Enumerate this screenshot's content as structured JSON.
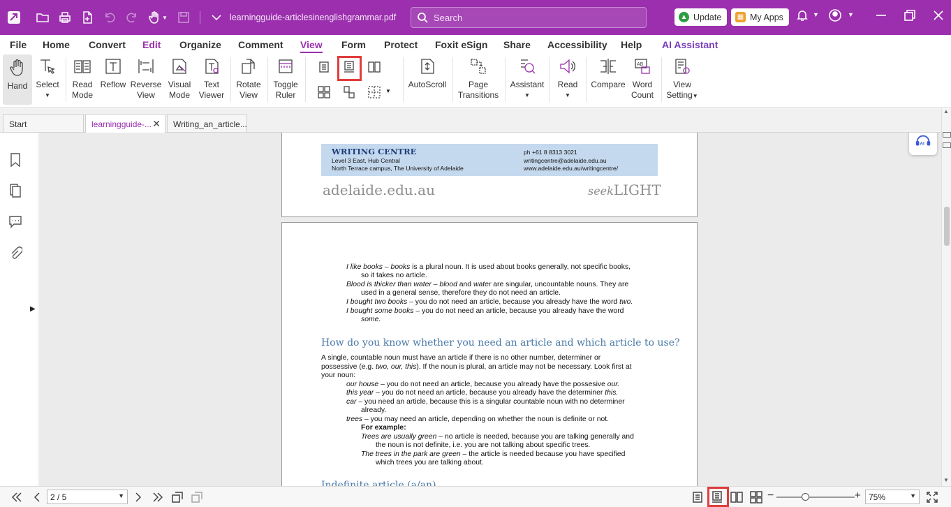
{
  "titlebar": {
    "filename": "learningguide-articlesinenglishgrammar.pdf",
    "search_placeholder": "Search",
    "update_label": "Update",
    "myapps_label": "My Apps"
  },
  "menu": [
    "File",
    "Home",
    "Convert",
    "Edit",
    "Organize",
    "Comment",
    "View",
    "Form",
    "Protect",
    "Foxit eSign",
    "Share",
    "Accessibility",
    "Help",
    "AI Assistant"
  ],
  "ribbon": {
    "hand": "Hand",
    "select": "Select",
    "read_mode_1": "Read",
    "read_mode_2": "Mode",
    "reflow": "Reflow",
    "reverse_1": "Reverse",
    "reverse_2": "View",
    "visual_1": "Visual",
    "visual_2": "Mode",
    "text_1": "Text",
    "text_2": "Viewer",
    "rotate_1": "Rotate",
    "rotate_2": "View",
    "ruler_1": "Toggle",
    "ruler_2": "Ruler",
    "autoscroll": "AutoScroll",
    "transitions_1": "Page",
    "transitions_2": "Transitions",
    "assistant": "Assistant",
    "read": "Read",
    "compare": "Compare",
    "word_1": "Word",
    "word_2": "Count",
    "setting_1": "View",
    "setting_2": "Setting"
  },
  "tabs": {
    "start": "Start",
    "tab1": "learningguide-...",
    "tab2": "Writing_an_article..."
  },
  "page1": {
    "centre": "WRITING CENTRE",
    "addr1": "Level 3 East, Hub Central",
    "addr2": "North Terrace campus, The University of Adelaide",
    "phone": "ph  +61 8 8313 3021",
    "email": "writingcentre@adelaide.edu.au",
    "web": "www.adelaide.edu.au/writingcentre/",
    "domain": "adelaide.edu.au",
    "seek": "seek",
    "light": "LIGHT"
  },
  "page2": {
    "l1a": "I like books –",
    "l1b": " books",
    "l1c": " is a plural noun. It is used about books generally, not specific books,",
    "l2": "so it takes no article.",
    "l3a": "Blood is thicker than water –",
    "l3b": " blood",
    "l3c": " and ",
    "l3d": "water",
    "l3e": " are singular, uncountable nouns. They are",
    "l4": "used in a general sense, therefore they do not need an article.",
    "l5a": "I bought two books –",
    "l5b": " you do not need an article, because you already have the word ",
    "l5c": "two.",
    "l6a": "I bought some books –",
    "l6b": " you do not need an article, because you already have the word",
    "l7": "some.",
    "heading": "How do you know whether you need an article and which article to use?",
    "p1": "A single, countable noun must have an article if there is no other number, determiner or",
    "p2a": "possessive (e.g. ",
    "p2b": "two, our, this",
    "p2c": "). If the noun is plural, an article may not be necessary. Look first at",
    "p3": "your noun:",
    "e1a": "our house –",
    "e1b": " you do not need an article, because you already have the possesive ",
    "e1c": "our.",
    "e2a": "this year –",
    "e2b": " you do not need an article, because you already have the determiner ",
    "e2c": "this.",
    "e3a": "car –",
    "e3b": " you need an article, because this is a singular countable noun with no determiner",
    "e4": "already.",
    "e5a": "trees –",
    "e5b": " you may need an article, depending on whether the noun is definite or not.",
    "fe": "For example:",
    "f1a": "Trees are usually green –",
    "f1b": " no article is needed, because you are talking generally and",
    "f2": "the noun is not definite, i.e. you are not talking about specific trees.",
    "f3a": "The trees in the park are green –",
    "f3b": " the article is needed because you have specified",
    "f4": "which trees you are talking about.",
    "next_heading": "Indefinite article (a/an)"
  },
  "status": {
    "page": "2 / 5",
    "zoom": "75%"
  },
  "colors": {
    "brand": "#9b2fae",
    "highlight": "#e03c3c",
    "header_band": "#c5d9ee"
  }
}
